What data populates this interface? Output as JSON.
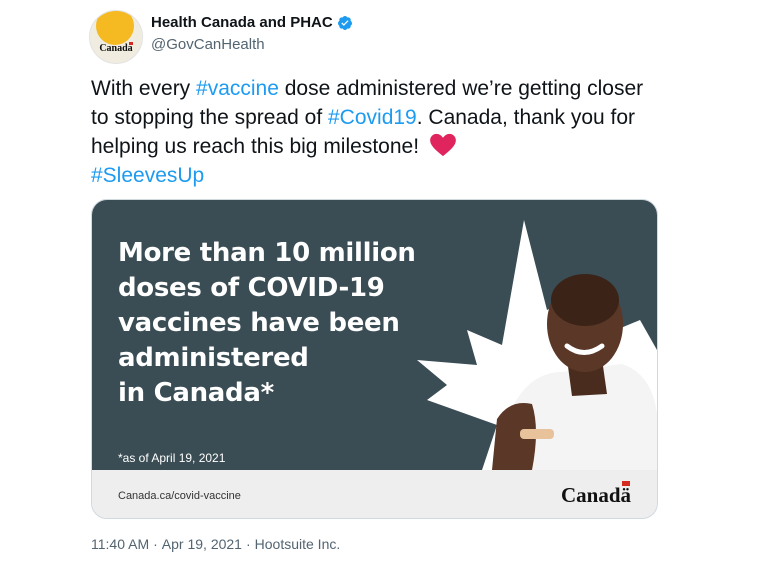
{
  "author": {
    "display_name": "Health Canada and PHAC",
    "handle": "@GovCanHealth",
    "avatar_text": "Canada",
    "verified": true
  },
  "tweet": {
    "segments": [
      {
        "text": "With every ",
        "hashtag": false
      },
      {
        "text": "#vaccine",
        "hashtag": true
      },
      {
        "text": " dose administered we’re getting closer to stopping the spread of ",
        "hashtag": false
      },
      {
        "text": "#Covid19",
        "hashtag": true
      },
      {
        "text": ". Canada, thank you for helping us reach this big milestone! ",
        "hashtag": false
      }
    ],
    "trailing_hashtag": "#SleevesUp",
    "emoji": "red-heart-icon"
  },
  "card": {
    "headline_lines": [
      "More than 10 million",
      "doses of COVID-19",
      "vaccines have been",
      "administered",
      "in Canada*"
    ],
    "footnote": "*as of April 19, 2021",
    "url": "Canada.ca/covid-vaccine",
    "wordmark": "Canadä",
    "colors": {
      "panel": "#3a4d55",
      "leaf": "#ffffff",
      "footer": "#eeeeee"
    }
  },
  "meta": {
    "time": "11:40 AM",
    "separator": "·",
    "date": "Apr 19, 2021",
    "source": "Hootsuite Inc."
  },
  "colors": {
    "link": "#1d9bf0",
    "secondary_text": "#536471",
    "verified": "#1d9bf0",
    "heart": "#e0245e"
  }
}
